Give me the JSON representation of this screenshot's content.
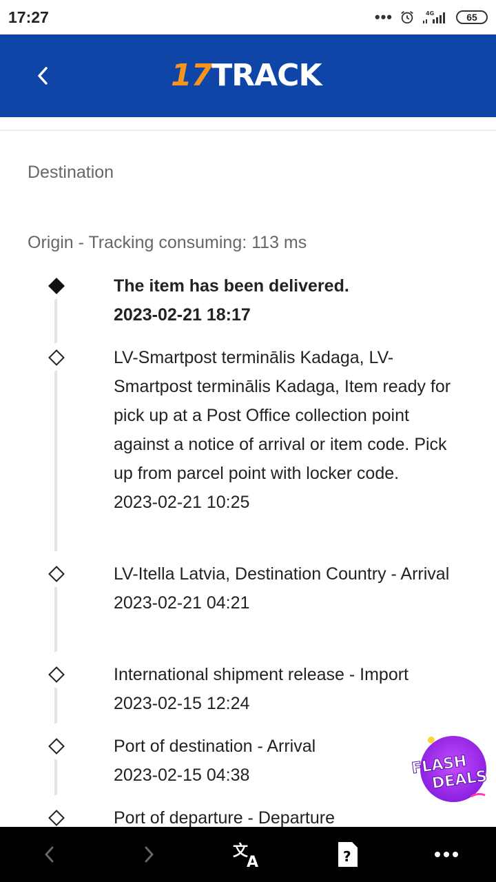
{
  "status_bar": {
    "time": "17:27",
    "network": "4G",
    "battery": "65",
    "icons": [
      "more-dots-icon",
      "alarm-icon",
      "signal-icon",
      "battery-icon"
    ]
  },
  "header": {
    "logo_number": "17",
    "logo_word": "TRACK",
    "background": "#0f45a7",
    "logo_accent": "#f7941d"
  },
  "sections": {
    "destination": "Destination",
    "origin": "Origin - Tracking consuming: 113 ms"
  },
  "events": [
    {
      "description": "The item has been delivered.",
      "datetime": "2023-02-21 18:17"
    },
    {
      "description": "LV-Smartpost terminālis Kadaga, LV-Smartpost terminālis Kadaga, Item ready for pick up at a Post Office collection point against a notice of arrival or item code. Pick up from parcel point with locker code.",
      "datetime": "2023-02-21 10:25"
    },
    {
      "description": "LV-Itella Latvia, Destination Country - Arrival",
      "datetime": "2023-02-21 04:21"
    },
    {
      "description": "International shipment release - Import",
      "datetime": "2023-02-15 12:24"
    },
    {
      "description": "Port of destination - Arrival",
      "datetime": "2023-02-15 04:38"
    },
    {
      "description": "Port of departure - Departure",
      "datetime": ""
    }
  ],
  "ad": {
    "line1": "FLASH",
    "line2": "DEALS"
  },
  "nav": [
    "back-icon",
    "forward-icon",
    "translate-icon",
    "help-card-icon",
    "more-icon"
  ]
}
